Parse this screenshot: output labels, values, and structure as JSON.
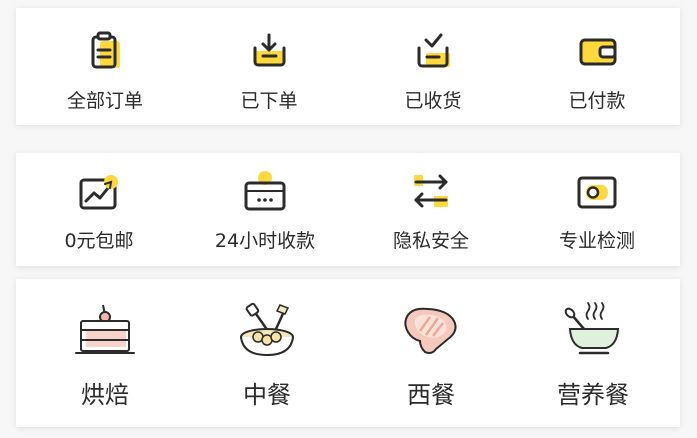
{
  "orders": {
    "items": [
      {
        "label": "全部订单",
        "icon": "clipboard-icon"
      },
      {
        "label": "已下单",
        "icon": "inbox-download-icon"
      },
      {
        "label": "已收货",
        "icon": "box-check-icon"
      },
      {
        "label": "已付款",
        "icon": "wallet-icon"
      }
    ]
  },
  "services": {
    "items": [
      {
        "label": "0元包邮",
        "icon": "trend-chart-icon"
      },
      {
        "label": "24小时收款",
        "icon": "payment-card-icon"
      },
      {
        "label": "隐私安全",
        "icon": "swap-arrows-icon"
      },
      {
        "label": "专业检测",
        "icon": "inspection-toggle-icon"
      }
    ]
  },
  "categories": {
    "items": [
      {
        "label": "烘焙",
        "icon": "cake-icon"
      },
      {
        "label": "中餐",
        "icon": "wok-icon"
      },
      {
        "label": "西餐",
        "icon": "steak-icon"
      },
      {
        "label": "营养餐",
        "icon": "soup-bowl-icon"
      }
    ]
  },
  "colors": {
    "accent_yellow": "#ffd83b",
    "stroke": "#2b2b2b",
    "pink": "#f7d3cc",
    "green": "#dff0dc"
  }
}
